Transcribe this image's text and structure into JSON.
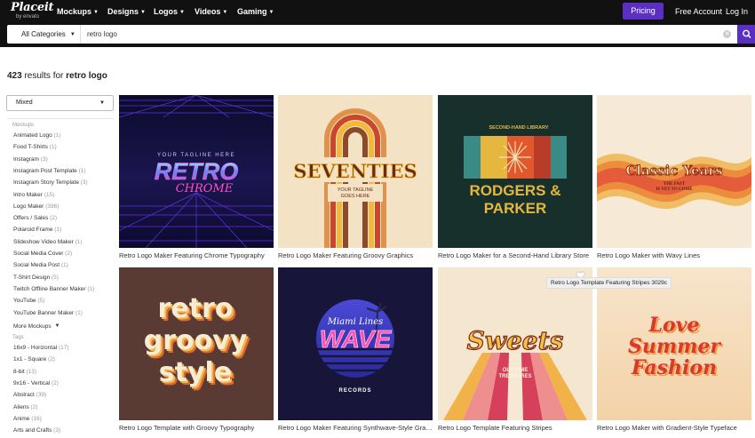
{
  "nav": {
    "logo_main": "Placeit",
    "logo_sub": "by envato",
    "menu": [
      "Mockups",
      "Designs",
      "Logos",
      "Videos",
      "Gaming"
    ],
    "pricing": "Pricing",
    "free_account": "Free Account",
    "login": "Log In"
  },
  "search": {
    "category": "All Categories",
    "query": "retro logo"
  },
  "results": {
    "count": "423",
    "prefix": " results for ",
    "query": "retro logo"
  },
  "sidebar": {
    "sort": "Mixed",
    "mockups_label": "Mockups",
    "items": [
      {
        "label": "Animated Logo",
        "count": "(1)"
      },
      {
        "label": "Food T-Shirts",
        "count": "(1)"
      },
      {
        "label": "Instagram",
        "count": "(3)"
      },
      {
        "label": "Instagram Post Template",
        "count": "(1)"
      },
      {
        "label": "Instagram Story Template",
        "count": "(3)"
      },
      {
        "label": "Intro Maker",
        "count": "(15)"
      },
      {
        "label": "Logo Maker",
        "count": "(396)"
      },
      {
        "label": "Offers / Sales",
        "count": "(2)"
      },
      {
        "label": "Polaroid Frame",
        "count": "(1)"
      },
      {
        "label": "Slideshow Video Maker",
        "count": "(1)"
      },
      {
        "label": "Social Media Cover",
        "count": "(2)"
      },
      {
        "label": "Social Media Post",
        "count": "(1)"
      },
      {
        "label": "T-Shirt Design",
        "count": "(5)"
      },
      {
        "label": "Twitch Offline Banner Maker",
        "count": "(1)"
      },
      {
        "label": "YouTube",
        "count": "(5)"
      },
      {
        "label": "YouTube Banner Maker",
        "count": "(1)"
      }
    ],
    "more_mockups": "More Mockups",
    "tags_label": "Tags",
    "tags": [
      {
        "label": "16x9 - Horizontal",
        "count": "(17)"
      },
      {
        "label": "1x1 - Square",
        "count": "(2)"
      },
      {
        "label": "8-bit",
        "count": "(13)"
      },
      {
        "label": "9x16 - Vertical",
        "count": "(2)"
      },
      {
        "label": "Abstract",
        "count": "(39)"
      },
      {
        "label": "Aliens",
        "count": "(2)"
      },
      {
        "label": "Anime",
        "count": "(16)"
      },
      {
        "label": "Arts and Crafts",
        "count": "(3)"
      }
    ]
  },
  "cards": [
    {
      "title": "Retro Logo Maker Featuring Chrome Typography",
      "art": [
        "YOUR TAGLINE HERE",
        "RETRO",
        "CHROME"
      ]
    },
    {
      "title": "Retro Logo Maker Featuring Groovy Graphics",
      "art": [
        "SEVENTIES",
        "YOUR TAGLINE",
        "GOES HERE"
      ]
    },
    {
      "title": "Retro Logo Maker for a Second-Hand Library Store",
      "art": [
        "SECOND-HAND LIBRARY",
        "RODGERS &",
        "PARKER"
      ]
    },
    {
      "title": "Retro Logo Maker with Wavy Lines",
      "art": [
        "Classic Years",
        "THE PAST",
        "IS YET TO COME"
      ]
    },
    {
      "title": "Retro Logo Template with Groovy Typography",
      "art": [
        "retro",
        "groovy",
        "style"
      ]
    },
    {
      "title": "Retro Logo Maker Featuring Synthwave-Style Graphics",
      "art": [
        "Miami Lines",
        "WAVE",
        "RECORDS"
      ]
    },
    {
      "title": "Retro Logo Template Featuring Stripes",
      "art": [
        "Sweets",
        "OLD TIME",
        "TREASURES"
      ]
    },
    {
      "title": "Retro Logo Maker with Gradient-Style Typeface",
      "art": [
        "Love",
        "Summer",
        "Fashion"
      ]
    }
  ],
  "tooltip": "Retro Logo Template Featuring Stripes 3029c",
  "colors": {
    "accent": "#5a2fc2",
    "nav_bg": "#111111"
  }
}
